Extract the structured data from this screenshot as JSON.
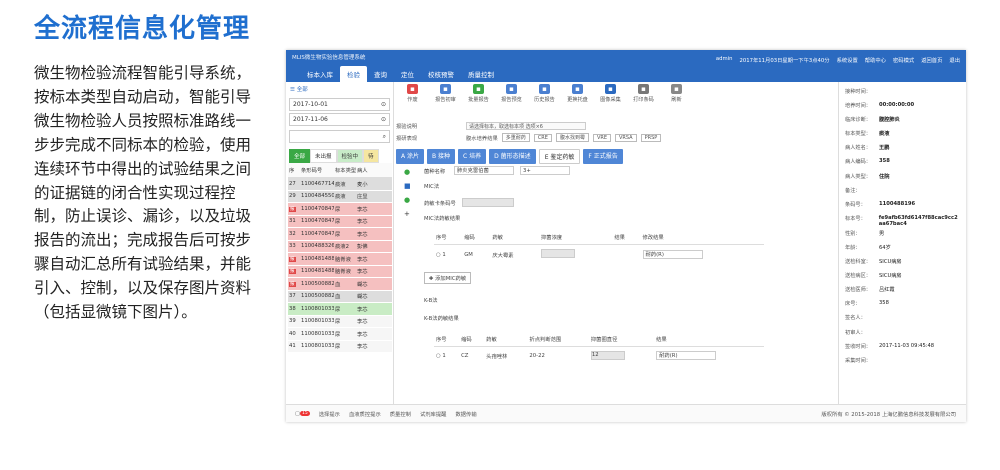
{
  "page": {
    "title": "全流程信息化管理",
    "description": "微生物检验流程智能引导系统，按标本类型自动启动，智能引导微生物检验人员按照标准路线一步步完成不同标本的检验，使用连续环节中得出的试验结果之间的证据链的闭合性实现过程控制，防止误诊、漏诊，以及垃圾报告的流出；完成报告后可按步骤自动汇总所有试验结果，并能引入、控制，以及保存图片资料（包括显微镜下图片）。"
  },
  "app": {
    "system_name": "MLIS微生物实验信息管理系统",
    "menu": [
      "标本入库",
      "检验",
      "查询",
      "定位",
      "校核预警",
      "质量控制"
    ],
    "active_menu": 1,
    "header_right": [
      "admin",
      "2017年11月03日星期一下午3点40分",
      "系统设置",
      "帮助中心",
      "密码模式",
      "返回首页",
      "退出"
    ]
  },
  "left": {
    "all_label": "全部",
    "date_from": "2017-10-01",
    "date_to": "2017-11-06",
    "status_tabs": [
      "全部",
      "未出报",
      "检验中",
      "待"
    ],
    "columns": [
      "序",
      "条形码号",
      "标本类型",
      "病人"
    ],
    "rows": [
      {
        "seq": "27",
        "code": "1100467714",
        "type": "痰液",
        "name": "麦小",
        "mark": "",
        "color": "gray"
      },
      {
        "seq": "29",
        "code": "1100484550",
        "type": "痰液",
        "name": "庄显",
        "mark": "",
        "color": "gray"
      },
      {
        "seq": "",
        "code": "1100470847",
        "type": "尿",
        "name": "李芯",
        "mark": "报",
        "color": "red"
      },
      {
        "seq": "31",
        "code": "1100470847",
        "type": "尿",
        "name": "李芯",
        "mark": "",
        "color": "red"
      },
      {
        "seq": "32",
        "code": "1100470847",
        "type": "尿",
        "name": "李芯",
        "mark": "",
        "color": "red"
      },
      {
        "seq": "33",
        "code": "1100488326",
        "type": "痰液2",
        "name": "彭佛",
        "mark": "",
        "color": "red"
      },
      {
        "seq": "",
        "code": "1100481488",
        "type": "脑脊液",
        "name": "李芯",
        "mark": "报",
        "color": "red"
      },
      {
        "seq": "",
        "code": "1100481488",
        "type": "脑脊液",
        "name": "李芯",
        "mark": "报",
        "color": "red"
      },
      {
        "seq": "",
        "code": "1100500882",
        "type": "血",
        "name": "蝴芯",
        "mark": "报",
        "color": "red"
      },
      {
        "seq": "37",
        "code": "1100500882",
        "type": "血",
        "name": "蝴芯",
        "mark": "",
        "color": "gray"
      },
      {
        "seq": "38",
        "code": "1100801033",
        "type": "尿",
        "name": "李芯",
        "mark": "",
        "color": "green"
      },
      {
        "seq": "39",
        "code": "1100801033",
        "type": "尿",
        "name": "李芯",
        "mark": "",
        "color": "white"
      },
      {
        "seq": "40",
        "code": "1100801033",
        "type": "尿",
        "name": "李芯",
        "mark": "",
        "color": "white"
      },
      {
        "seq": "41",
        "code": "1100801033",
        "type": "尿",
        "name": "李芯",
        "mark": "",
        "color": "white"
      }
    ]
  },
  "toolbar": [
    {
      "label": "作废",
      "icon": "void-icon",
      "color": "#e04848"
    },
    {
      "label": "报告初审",
      "icon": "report-review-icon",
      "color": "#4a7fd0"
    },
    {
      "label": "批量报告",
      "icon": "batch-report-icon",
      "color": "#3aa845"
    },
    {
      "label": "报告预览",
      "icon": "report-preview-icon",
      "color": "#4a7fd0"
    },
    {
      "label": "历史报告",
      "icon": "history-report-icon",
      "color": "#4a7fd0"
    },
    {
      "label": "更换托盘",
      "icon": "swap-tray-icon",
      "color": "#4a7fd0"
    },
    {
      "label": "图像采集",
      "icon": "camera-icon",
      "color": "#2b6ac0"
    },
    {
      "label": "打印条码",
      "icon": "print-icon",
      "color": "#777777"
    },
    {
      "label": "刷新",
      "icon": "refresh-icon",
      "color": "#888888"
    }
  ],
  "form": {
    "row1_label": "报验说明",
    "row1_placeholder": "请选择标本，取选标本项 选项×6",
    "row2_label": "报研表现",
    "row2_text1": "腹水培养结果",
    "row2_chips": [
      "多重耐药",
      "CRE",
      "腹水找到霉",
      "VRE",
      "VRSA",
      "PRSP"
    ]
  },
  "steps": [
    "A 涂片",
    "B 接种",
    "C 培养",
    "D 菌形态描述",
    "E 鉴定药敏",
    "F 正式报告"
  ],
  "detail": {
    "organism_label": "菌种名称",
    "organism_value": "肺炎克雷伯菌",
    "count_value": "3+",
    "mic_title": "MIC法",
    "mic_code_label": "药敏卡条码号",
    "mic_result_title": "MIC法药敏结果",
    "mic_columns": [
      "序号",
      "缩码",
      "药敏",
      "抑菌浓度",
      "结果",
      "修改结果"
    ],
    "mic_row": {
      "no": "1",
      "code": "GM",
      "drug": "庆大霉素",
      "result": "耐药(R)"
    },
    "add_mic_label": "添加MIC药敏",
    "kb_title": "K-B法",
    "kb_result_title": "K-B法药敏结果",
    "kb_columns": [
      "序号",
      "缩码",
      "药敏",
      "折点判断范围",
      "抑菌圈直径",
      "结果"
    ],
    "kb_row": {
      "no": "1",
      "code": "CZ",
      "drug": "头孢唑林",
      "range": "20-22",
      "diameter": "12",
      "result": "耐药(R)"
    }
  },
  "right": {
    "rows": [
      {
        "k": "接种时间：",
        "v": ""
      },
      {
        "k": "培养时间：",
        "v": "00:00:00:00"
      },
      {
        "k": "临床诊断：",
        "v": "腹腔肺炎"
      },
      {
        "k": "标本类型：",
        "v": "痰液"
      },
      {
        "k": "病人姓名：",
        "v": "王鹏"
      },
      {
        "k": "病人编码：",
        "v": "358"
      },
      {
        "k": "病人类型：",
        "v": "住院"
      },
      {
        "k": "备注：",
        "v": ""
      },
      {
        "k": "条码号：",
        "v": "1100488196"
      },
      {
        "k": "标本号：",
        "v": "fe9afb63fd6147f88cac9cc2aa67bac4"
      },
      {
        "k": "性别：",
        "v": "男"
      },
      {
        "k": "年龄：",
        "v": "64岁"
      },
      {
        "k": "送检科室：",
        "v": "SICU病房"
      },
      {
        "k": "送检病区：",
        "v": "SICU病房"
      },
      {
        "k": "送检医师：",
        "v": "吕红霞"
      },
      {
        "k": "床号：",
        "v": "358"
      },
      {
        "k": "签名人：",
        "v": ""
      },
      {
        "k": "初审人：",
        "v": ""
      },
      {
        "k": "签收时间：",
        "v": "2017-11-03 09:45:48"
      },
      {
        "k": "采集时间：",
        "v": ""
      }
    ]
  },
  "footer": {
    "items": [
      "选择提示",
      "血液质控提示",
      "质量控制",
      "试剂库提醒",
      "数据传输"
    ],
    "badge": "15",
    "copyright": "版权所有 © 2015-2018 上海亿鹏信息科技发展有限公司"
  }
}
